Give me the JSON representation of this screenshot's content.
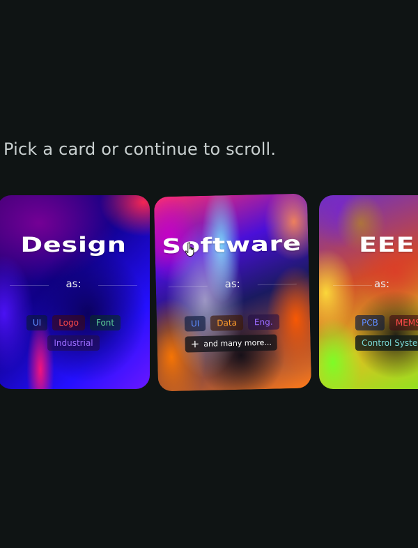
{
  "prompt": "Pick a card or continue to scroll.",
  "cards": [
    {
      "title": "Design",
      "as_label": "as:",
      "tags": [
        {
          "label": "UI",
          "color": "#5f8cff"
        },
        {
          "label": "Logo",
          "color": "#ff4a4a"
        },
        {
          "label": "Font",
          "color": "#5fd39a"
        },
        {
          "label": "Industrial",
          "color": "#9b6bff"
        }
      ]
    },
    {
      "title": "Software",
      "as_label": "as:",
      "tags": [
        {
          "label": "UI",
          "color": "#5f8cff"
        },
        {
          "label": "Data",
          "color": "#ff9c2a"
        },
        {
          "label": "Eng.",
          "color": "#9b6bff"
        }
      ],
      "more_label": "and many more..."
    },
    {
      "title": "EEE",
      "as_label": "as:",
      "tags": [
        {
          "label": "PCB",
          "color": "#5f8cff"
        },
        {
          "label": "MEMS",
          "color": "#ff4a4a"
        },
        {
          "label": "Control Systems",
          "color": "#7ad9d6"
        }
      ]
    }
  ],
  "icons": {
    "cursor": "hand-pointer-icon",
    "more": "plus-icon"
  }
}
